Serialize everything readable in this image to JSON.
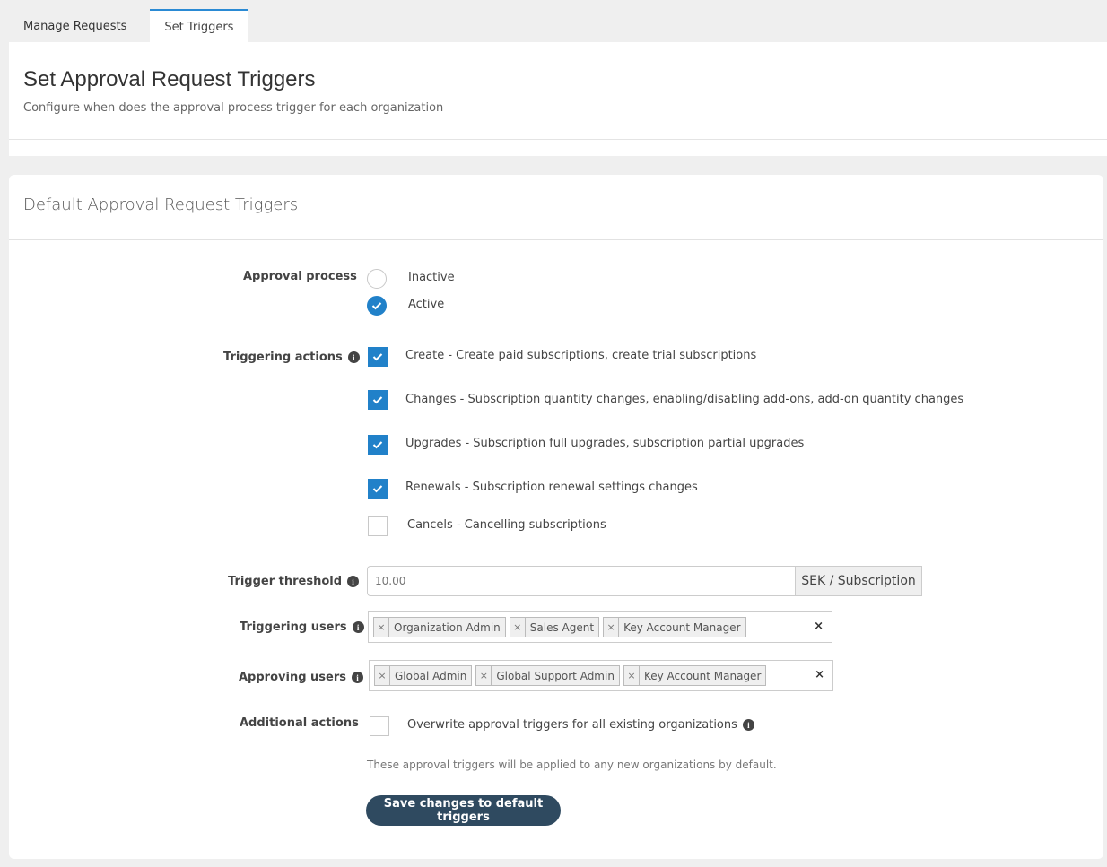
{
  "tabs": [
    {
      "label": "Manage Requests",
      "active": false
    },
    {
      "label": "Set Triggers",
      "active": true
    }
  ],
  "header": {
    "title": "Set Approval Request Triggers",
    "subtitle": "Configure when does the approval process trigger for each organization"
  },
  "card": {
    "title": "Default Approval Request Triggers"
  },
  "approval_process": {
    "label": "Approval process",
    "options": [
      {
        "label": "Inactive",
        "checked": false
      },
      {
        "label": "Active",
        "checked": true
      }
    ]
  },
  "triggering_actions": {
    "label": "Triggering actions",
    "icon": "info-icon",
    "items": [
      {
        "label": "Create - Create paid subscriptions, create trial subscriptions",
        "checked": true
      },
      {
        "label": "Changes - Subscription quantity changes, enabling/disabling add-ons, add-on quantity changes",
        "checked": true
      },
      {
        "label": "Upgrades - Subscription full upgrades, subscription partial upgrades",
        "checked": true
      },
      {
        "label": "Renewals - Subscription renewal settings changes",
        "checked": true
      },
      {
        "label": "Cancels - Cancelling subscriptions",
        "checked": false
      }
    ]
  },
  "trigger_threshold": {
    "label": "Trigger threshold",
    "placeholder": "10.00",
    "unit": "SEK / Subscription"
  },
  "triggering_users": {
    "label": "Triggering users",
    "tags": [
      "Organization Admin",
      "Sales Agent",
      "Key Account Manager"
    ],
    "clear": "×",
    "remove": "×"
  },
  "approving_users": {
    "label": "Approving users",
    "tags": [
      "Global Admin",
      "Global Support Admin",
      "Key Account Manager"
    ],
    "clear": "×",
    "remove": "×"
  },
  "additional_actions": {
    "label": "Additional actions",
    "overwrite_label": "Overwrite approval triggers for all existing organizations",
    "checked": false
  },
  "hint": "These approval triggers will be applied to any new organizations by default.",
  "save_label": "Save changes to default triggers",
  "info_glyph": "i",
  "colors": {
    "accent": "#2181c9",
    "button": "#2f4a60",
    "tab_border": "#2a8ad4"
  }
}
